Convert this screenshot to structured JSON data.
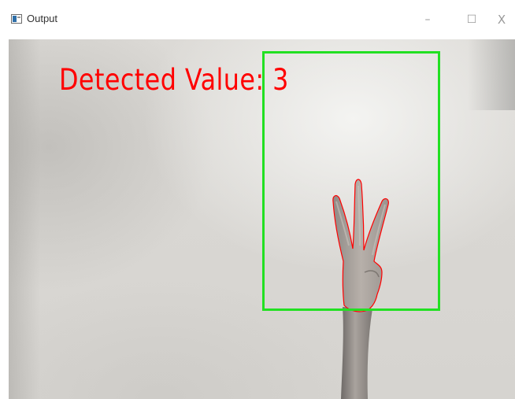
{
  "window": {
    "title": "Output",
    "controls": {
      "minimize": "–",
      "maximize": "☐",
      "close": "X"
    }
  },
  "output": {
    "label": "Detected Value: 3",
    "text_color": "#ff0000",
    "box_color": "#22e022",
    "contour_color": "#ff0000"
  }
}
